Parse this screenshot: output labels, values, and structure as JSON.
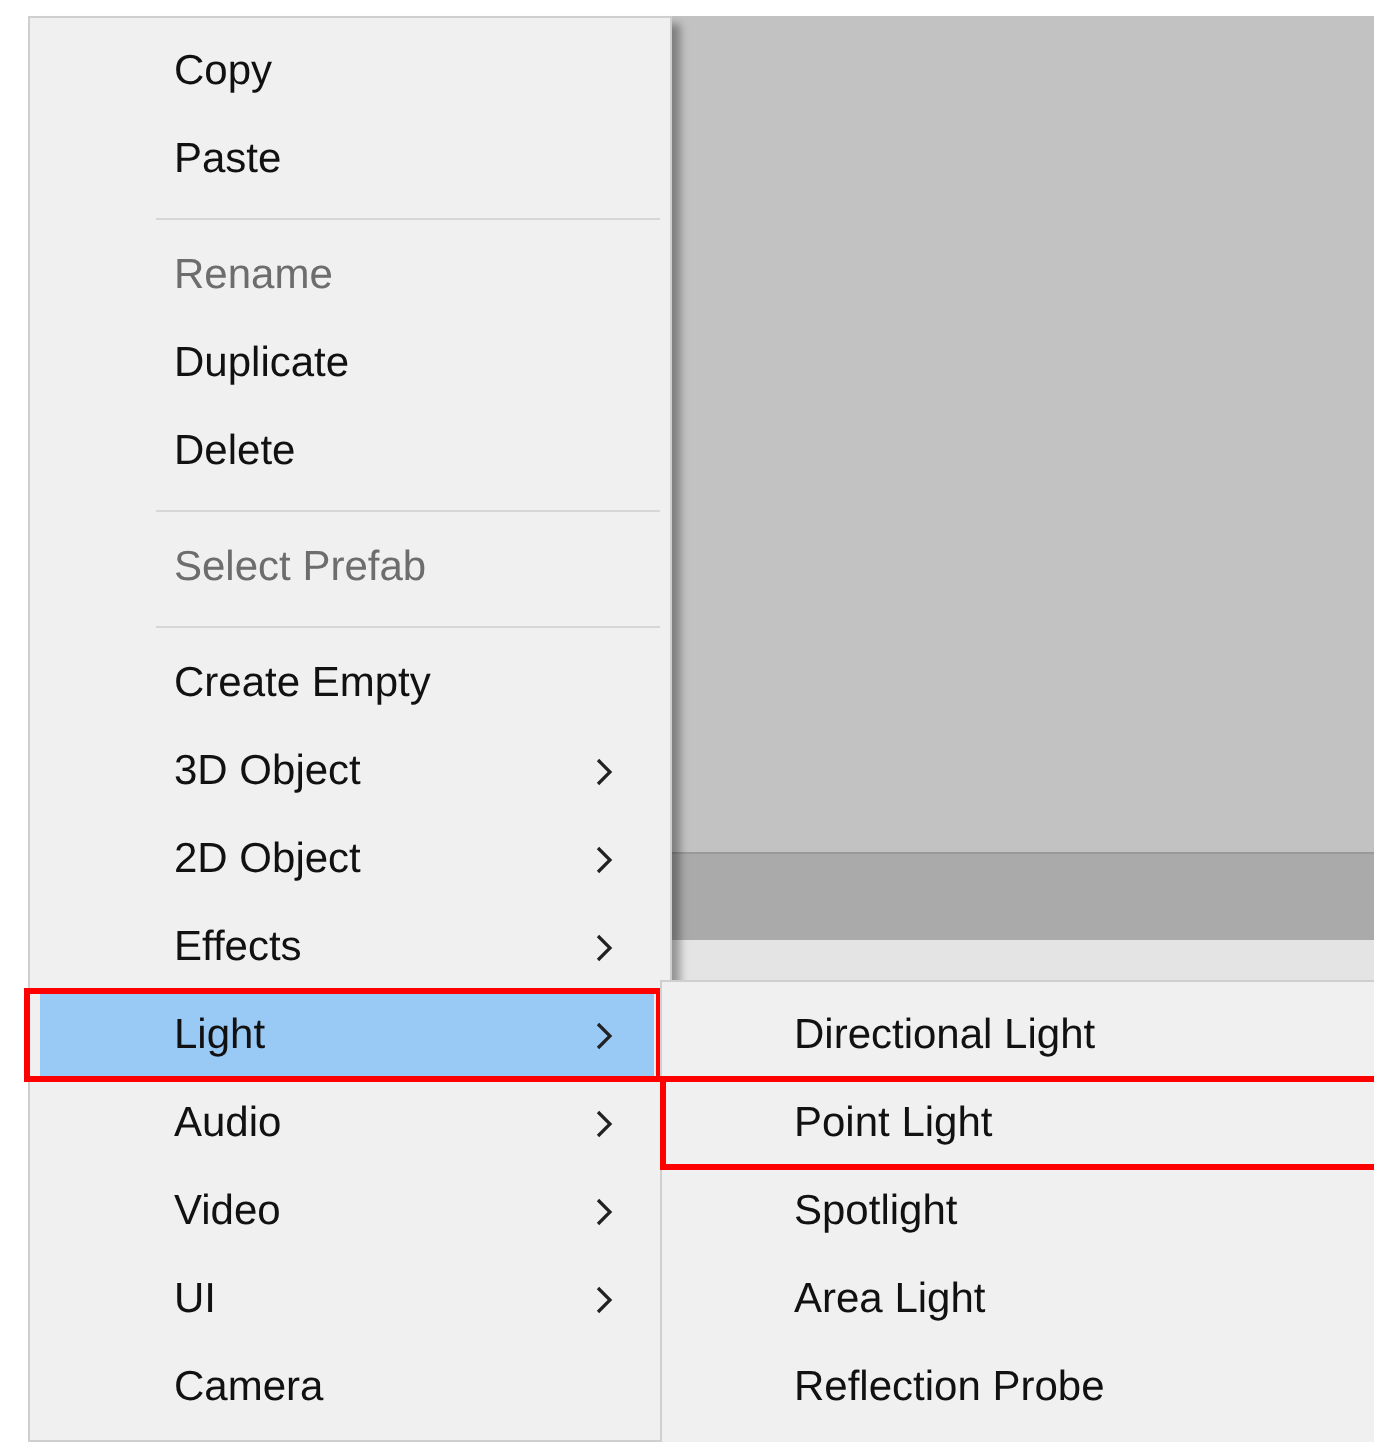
{
  "context_menu": {
    "items": [
      {
        "kind": "item",
        "label": "Copy",
        "disabled": false,
        "has_submenu": false,
        "selected": false,
        "annotated": false
      },
      {
        "kind": "item",
        "label": "Paste",
        "disabled": false,
        "has_submenu": false,
        "selected": false,
        "annotated": false
      },
      {
        "kind": "separator"
      },
      {
        "kind": "item",
        "label": "Rename",
        "disabled": true,
        "has_submenu": false,
        "selected": false,
        "annotated": false
      },
      {
        "kind": "item",
        "label": "Duplicate",
        "disabled": false,
        "has_submenu": false,
        "selected": false,
        "annotated": false
      },
      {
        "kind": "item",
        "label": "Delete",
        "disabled": false,
        "has_submenu": false,
        "selected": false,
        "annotated": false
      },
      {
        "kind": "separator"
      },
      {
        "kind": "item",
        "label": "Select Prefab",
        "disabled": true,
        "has_submenu": false,
        "selected": false,
        "annotated": false
      },
      {
        "kind": "separator"
      },
      {
        "kind": "item",
        "label": "Create Empty",
        "disabled": false,
        "has_submenu": false,
        "selected": false,
        "annotated": false
      },
      {
        "kind": "item",
        "label": "3D Object",
        "disabled": false,
        "has_submenu": true,
        "selected": false,
        "annotated": false
      },
      {
        "kind": "item",
        "label": "2D Object",
        "disabled": false,
        "has_submenu": true,
        "selected": false,
        "annotated": false
      },
      {
        "kind": "item",
        "label": "Effects",
        "disabled": false,
        "has_submenu": true,
        "selected": false,
        "annotated": false
      },
      {
        "kind": "item",
        "label": "Light",
        "disabled": false,
        "has_submenu": true,
        "selected": true,
        "annotated": true
      },
      {
        "kind": "item",
        "label": "Audio",
        "disabled": false,
        "has_submenu": true,
        "selected": false,
        "annotated": false
      },
      {
        "kind": "item",
        "label": "Video",
        "disabled": false,
        "has_submenu": true,
        "selected": false,
        "annotated": false
      },
      {
        "kind": "item",
        "label": "UI",
        "disabled": false,
        "has_submenu": true,
        "selected": false,
        "annotated": false
      },
      {
        "kind": "item",
        "label": "Camera",
        "disabled": false,
        "has_submenu": false,
        "selected": false,
        "annotated": false
      }
    ]
  },
  "submenu": {
    "items": [
      {
        "label": "Directional Light",
        "annotated": false
      },
      {
        "label": "Point Light",
        "annotated": true
      },
      {
        "label": "Spotlight",
        "annotated": false
      },
      {
        "label": "Area Light",
        "annotated": false
      },
      {
        "label": "Reflection Probe",
        "annotated": false
      }
    ]
  }
}
